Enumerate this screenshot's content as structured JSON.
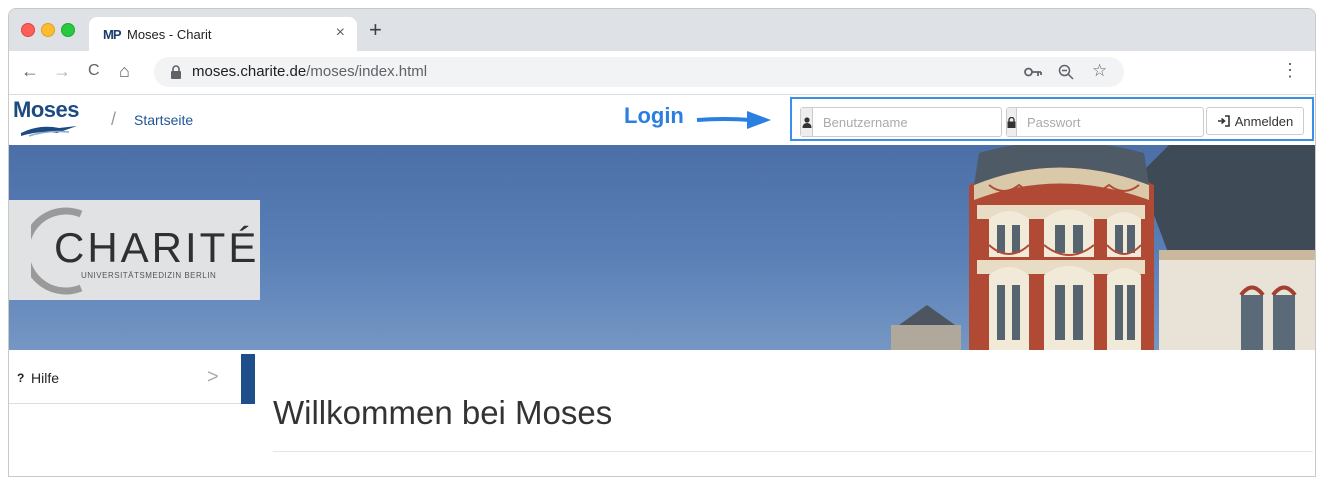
{
  "browser": {
    "tab": {
      "favicon": "MP",
      "title": "Moses - Charit",
      "close": "×"
    },
    "new_tab": "+",
    "nav": {
      "back": "←",
      "forward": "→",
      "reload": "C",
      "home": "⌂"
    },
    "url": {
      "host": "moses.charite.de",
      "path": "/moses/index.html"
    },
    "menu": "⋮",
    "icons": [
      "key-icon",
      "zoom-icon",
      "star-icon"
    ]
  },
  "site": {
    "logo": "Moses",
    "breadcrumb_sep": "/",
    "breadcrumb": "Startseite",
    "annotation": "Login",
    "login": {
      "username_placeholder": "Benutzername",
      "password_placeholder": "Passwort",
      "submit_label": "Anmelden"
    }
  },
  "banner": {
    "brand": "CHARITÉ",
    "brand_sub": "UNIVERSITÄTSMEDIZIN BERLIN"
  },
  "sidebar": {
    "items": [
      {
        "icon": "?",
        "label": "Hilfe",
        "chevron": ">"
      }
    ]
  },
  "main": {
    "heading": "Willkommen bei Moses"
  },
  "colors": {
    "accent": "#1f4f8a",
    "annotation": "#2a7fe0",
    "sky": "#5a80b7"
  }
}
